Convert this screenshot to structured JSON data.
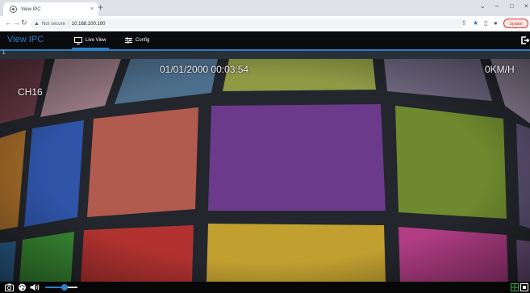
{
  "browser": {
    "tab_title": "View IPC",
    "tab_close": "×",
    "new_tab": "+",
    "security_label": "Not secure",
    "url": "10.168.100.100",
    "update_label": "Update",
    "win_min": "–",
    "win_max": "□",
    "win_close": "×",
    "win_down": "⌄"
  },
  "app": {
    "title": "View IPC",
    "nav": [
      {
        "label": "Live View",
        "icon": "monitor-icon",
        "active": true
      },
      {
        "label": "Config",
        "icon": "sliders-icon",
        "active": false
      }
    ]
  },
  "strip": {
    "channel_index": "1"
  },
  "video": {
    "datetime": "01/01/2000 00:03:54",
    "speed": "0KM/H",
    "channel": "CH16"
  },
  "controls": {
    "volume_level": 0.6,
    "icons": [
      "camera-icon",
      "palette-icon",
      "speaker-icon",
      "volume-slider",
      "grid-icon",
      "fullscreen-icon"
    ]
  },
  "colors": {
    "accent": "#2a7fc7",
    "header_bg": "#0a0b0d"
  }
}
